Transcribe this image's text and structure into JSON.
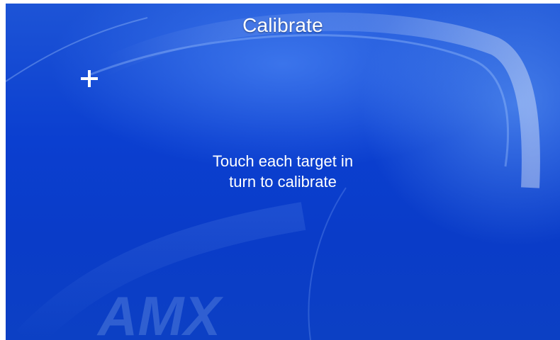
{
  "screen": {
    "title": "Calibrate",
    "instruction_line1": "Touch each target in",
    "instruction_line2": "turn to calibrate",
    "target_icon": "crosshair-plus-icon",
    "watermark": "AMX"
  },
  "colors": {
    "background": "#0b3fd0",
    "text": "#ffffff"
  }
}
